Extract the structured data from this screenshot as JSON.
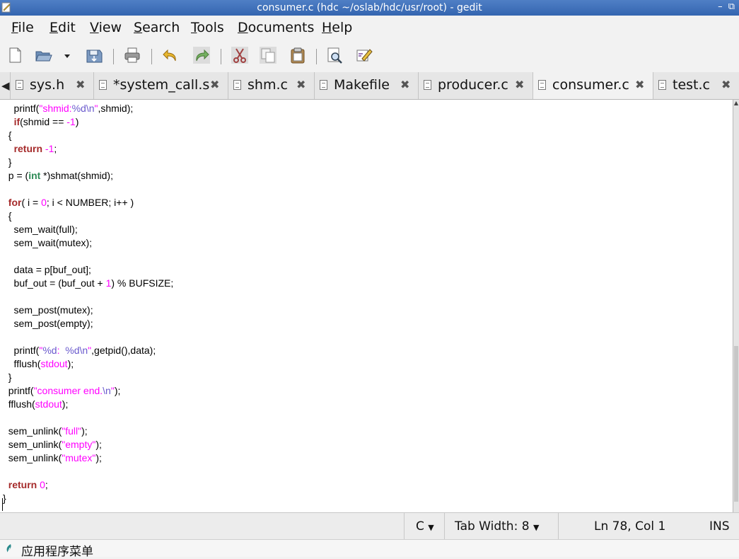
{
  "window": {
    "title": "consumer.c (hdc ~/oslab/hdc/usr/root) - gedit",
    "controls": "– ⧉"
  },
  "menu": [
    {
      "mnemonic": "F",
      "rest": "ile"
    },
    {
      "mnemonic": "E",
      "rest": "dit"
    },
    {
      "mnemonic": "V",
      "rest": "iew"
    },
    {
      "mnemonic": "S",
      "rest": "earch"
    },
    {
      "mnemonic": "T",
      "rest": "ools"
    },
    {
      "mnemonic": "D",
      "rest": "ocuments"
    },
    {
      "mnemonic": "H",
      "rest": "elp"
    }
  ],
  "toolbar": {
    "icons": [
      "new-document-icon",
      "open-icon",
      "open-dropdown-icon",
      "save-icon",
      "print-icon",
      "undo-icon",
      "redo-icon",
      "cut-icon",
      "copy-icon",
      "paste-icon",
      "find-icon",
      "find-replace-icon"
    ]
  },
  "tabs": [
    {
      "label": "sys.h",
      "close": "✖"
    },
    {
      "label": "*system_call.s",
      "close": "✖"
    },
    {
      "label": "shm.c",
      "close": "✖"
    },
    {
      "label": "Makefile",
      "close": "✖"
    },
    {
      "label": "producer.c",
      "close": "✖"
    },
    {
      "label": "consumer.c",
      "close": "✖"
    },
    {
      "label": "test.c",
      "close": "✖"
    }
  ],
  "tabs_scroll_left": "◀",
  "code_lines": [
    "    printf(\"shmid:%d\\n\",shmid);",
    "    if(shmid == -1)",
    "  {",
    "    return -1;",
    "  }",
    "  p = (int *)shmat(shmid);",
    "",
    "  for( i = 0; i < NUMBER; i++ )",
    "  {",
    "    sem_wait(full);",
    "    sem_wait(mutex);",
    "",
    "    data = p[buf_out];",
    "    buf_out = (buf_out + 1) % BUFSIZE;",
    "",
    "    sem_post(mutex);",
    "    sem_post(empty);",
    "",
    "    printf(\"%d:  %d\\n\",getpid(),data);",
    "    fflush(stdout);",
    "  }",
    "  printf(\"consumer end.\\n\");",
    "  fflush(stdout);",
    "",
    "  sem_unlink(\"full\");",
    "  sem_unlink(\"empty\");",
    "  sem_unlink(\"mutex\");",
    "",
    "  return 0;",
    "}"
  ],
  "status": {
    "language": "C",
    "tab_width": "Tab Width:  8",
    "position": "Ln 78, Col 1",
    "mode": "INS",
    "dropdown_arrow": "▼"
  },
  "panel": {
    "menu_label": "应用程序菜单"
  },
  "colors": {
    "keyword": "#a52a2a",
    "type": "#2e8b57",
    "number": "#ff00ff",
    "string": "#ff00ff",
    "format": "#6a5acd",
    "titlebar": "#3a6cb8"
  }
}
